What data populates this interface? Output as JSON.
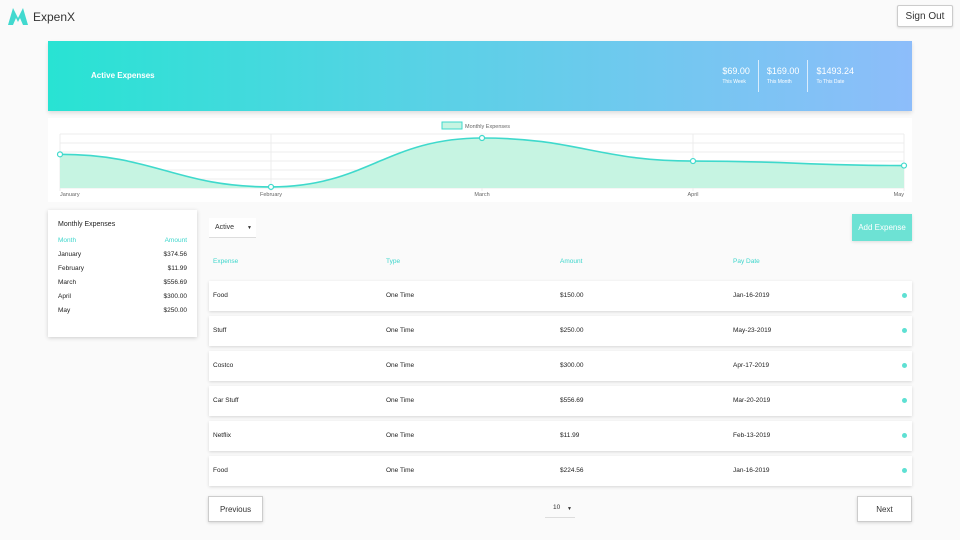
{
  "app": {
    "name": "ExpenX"
  },
  "header": {
    "sign_out_label": "Sign Out"
  },
  "banner": {
    "title": "Active Expenses",
    "stats": [
      {
        "value": "$69.00",
        "label": "This Week"
      },
      {
        "value": "$169.00",
        "label": "This Month"
      },
      {
        "value": "$1493.24",
        "label": "To This Date"
      }
    ]
  },
  "chart_data": {
    "type": "area",
    "categories": [
      "January",
      "February",
      "March",
      "April",
      "May"
    ],
    "series": [
      {
        "name": "Monthly Expenses",
        "values": [
          374.56,
          11.99,
          556.69,
          300.0,
          250.0
        ]
      }
    ],
    "legend": "top-center",
    "grid": true,
    "colors": {
      "line": "#3fd9cc",
      "fill": "#c6f4e2"
    }
  },
  "monthly": {
    "title": "Monthly Expenses",
    "col_month": "Month",
    "col_amount": "Amount",
    "rows": [
      {
        "month": "January",
        "amount": "$374.56"
      },
      {
        "month": "February",
        "amount": "$11.99"
      },
      {
        "month": "March",
        "amount": "$556.69"
      },
      {
        "month": "April",
        "amount": "$300.00"
      },
      {
        "month": "May",
        "amount": "$250.00"
      }
    ]
  },
  "filter": {
    "selected": "Active"
  },
  "add_expense_label": "Add Expense",
  "table": {
    "headers": [
      "Expense",
      "Type",
      "Amount",
      "Pay Date"
    ],
    "rows": [
      {
        "expense": "Food",
        "type": "One Time",
        "amount": "$150.00",
        "date": "Jan-16-2019"
      },
      {
        "expense": "Stuff",
        "type": "One Time",
        "amount": "$250.00",
        "date": "May-23-2019"
      },
      {
        "expense": "Costco",
        "type": "One Time",
        "amount": "$300.00",
        "date": "Apr-17-2019"
      },
      {
        "expense": "Car Stuff",
        "type": "One Time",
        "amount": "$556.69",
        "date": "Mar-20-2019"
      },
      {
        "expense": "Netflix",
        "type": "One Time",
        "amount": "$11.99",
        "date": "Feb-13-2019"
      },
      {
        "expense": "Food",
        "type": "One Time",
        "amount": "$224.56",
        "date": "Jan-16-2019"
      }
    ]
  },
  "pagination": {
    "previous_label": "Previous",
    "next_label": "Next",
    "page_size": "10"
  },
  "colors": {
    "accent": "#3ed6cc",
    "banner_start": "#28e3d3",
    "banner_end": "#8dbdfa"
  }
}
